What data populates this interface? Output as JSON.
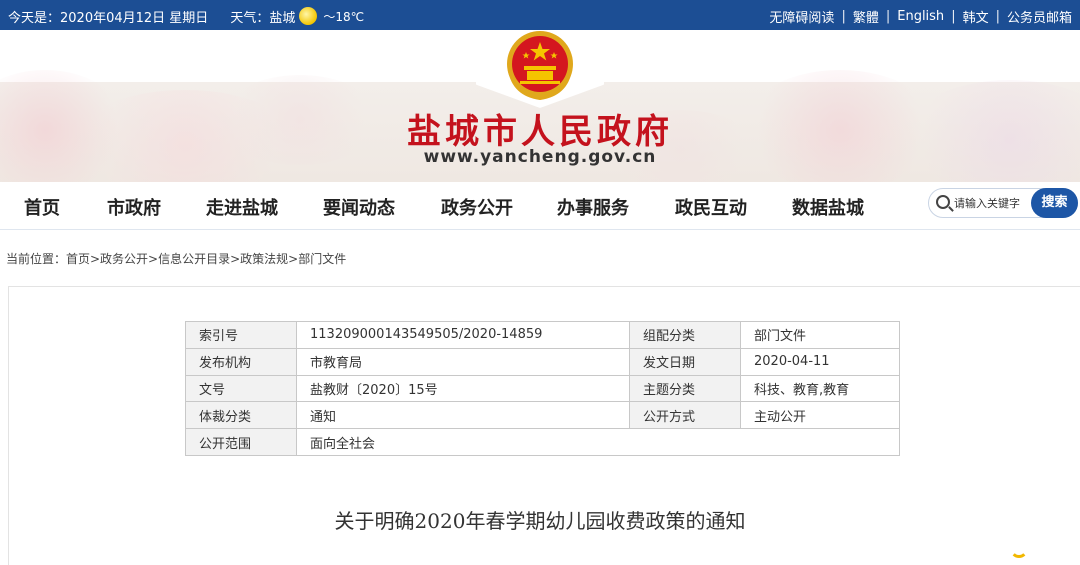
{
  "topbar": {
    "date_text": "今天是：2020年04月12日 星期日",
    "weather_label": "天气：",
    "weather_city": "盐城",
    "weather_temp": "～18℃",
    "links": [
      "无障碍阅读",
      "繁體",
      "English",
      "韩文",
      "公务员邮箱"
    ]
  },
  "header": {
    "site_title": "盐城市人民政府",
    "site_url": "www.yancheng.gov.cn"
  },
  "nav": {
    "items": [
      "首页",
      "市政府",
      "走进盐城",
      "要闻动态",
      "政务公开",
      "办事服务",
      "政民互动",
      "数据盐城"
    ],
    "search_placeholder": "请输入关键字",
    "search_button": "搜索"
  },
  "breadcrumb": "当前位置：首页>政务公开>信息公开目录>政策法规>部门文件",
  "meta_table": {
    "rows": [
      [
        {
          "k": "索引号",
          "v": "113209000143549505/2020-14859"
        },
        {
          "k": "组配分类",
          "v": "部门文件"
        }
      ],
      [
        {
          "k": "发布机构",
          "v": "市教育局"
        },
        {
          "k": "发文日期",
          "v": "2020-04-11"
        }
      ],
      [
        {
          "k": "文号",
          "v": "盐教财〔2020〕15号"
        },
        {
          "k": "主题分类",
          "v": "科技、教育,教育"
        }
      ],
      [
        {
          "k": "体裁分类",
          "v": "通知"
        },
        {
          "k": "公开方式",
          "v": "主动公开"
        }
      ],
      [
        {
          "k": "公开范围",
          "v": "面向全社会"
        }
      ]
    ]
  },
  "document": {
    "title": "关于明确2020年春学期幼儿园收费政策的通知"
  },
  "colors": {
    "topbar_bg": "#1c4e94",
    "title_red": "#c4121d",
    "search_button_bg": "#1d56a6"
  }
}
